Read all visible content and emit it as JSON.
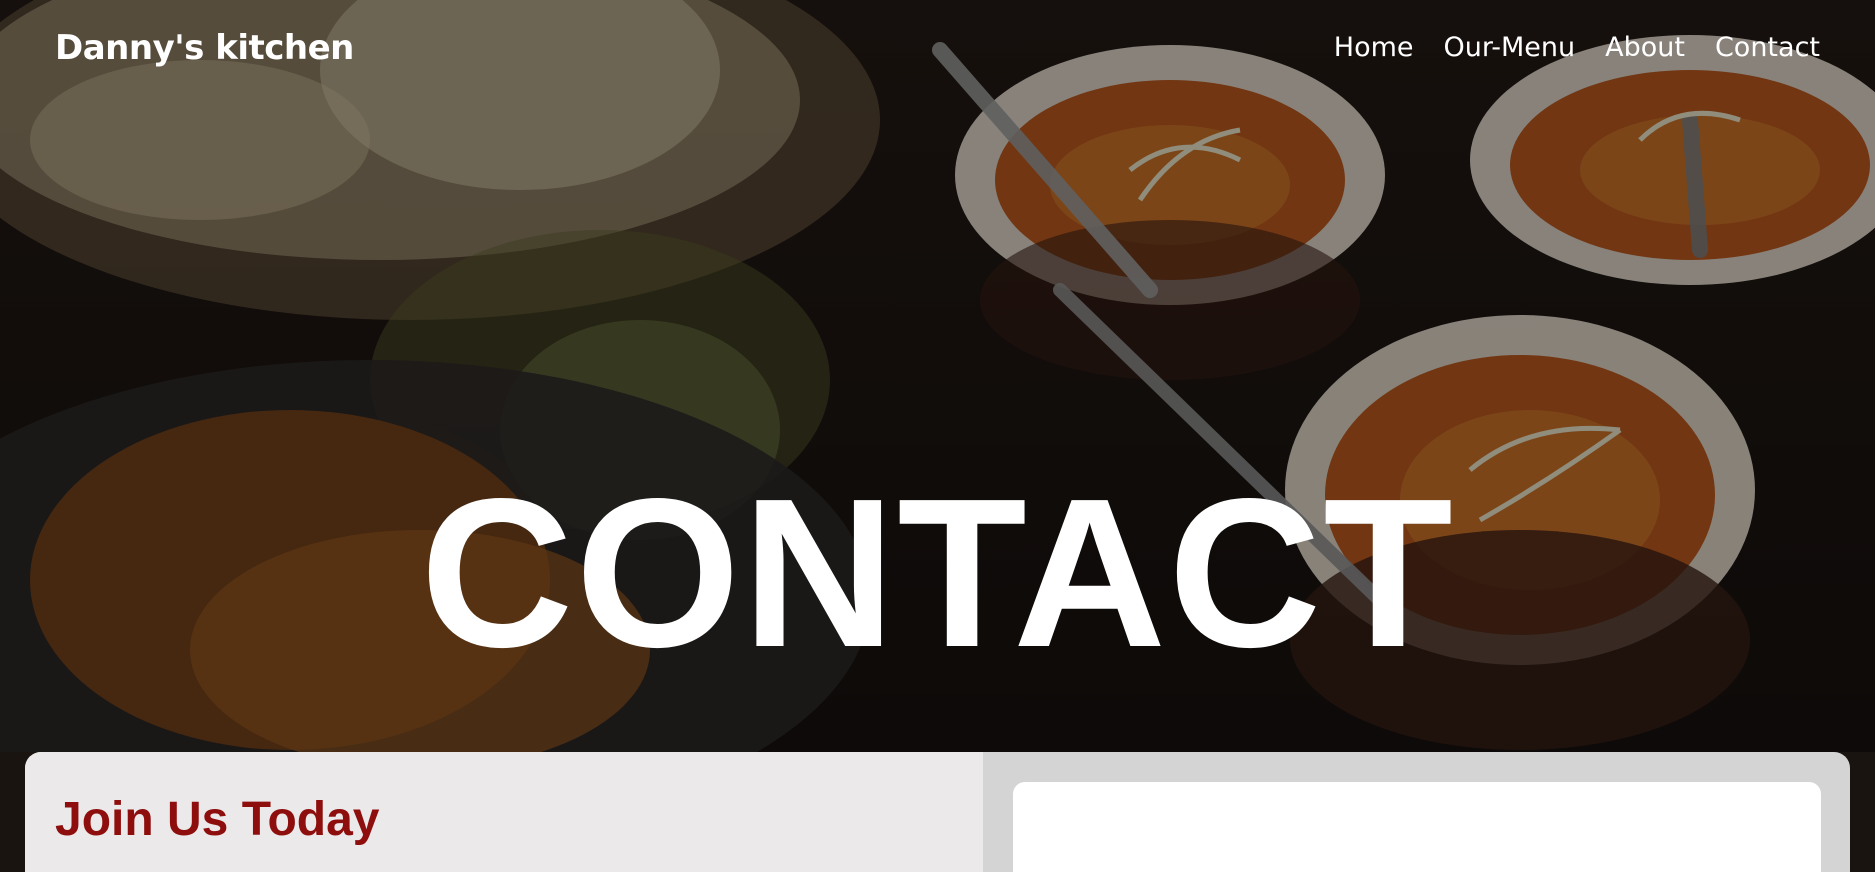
{
  "navbar": {
    "brand": "Danny's kitchen",
    "links": [
      {
        "label": "Home"
      },
      {
        "label": "Our-Menu"
      },
      {
        "label": "About"
      },
      {
        "label": "Contact"
      }
    ]
  },
  "hero": {
    "title": "CONTACT"
  },
  "join": {
    "title": "Join Us Today"
  },
  "colors": {
    "accent": "#8e0e0e",
    "panel_left_bg": "#ebe9ea",
    "panel_right_bg": "#d4d4d4",
    "card_bg": "#ffffff",
    "nav_text": "#ffffff"
  }
}
